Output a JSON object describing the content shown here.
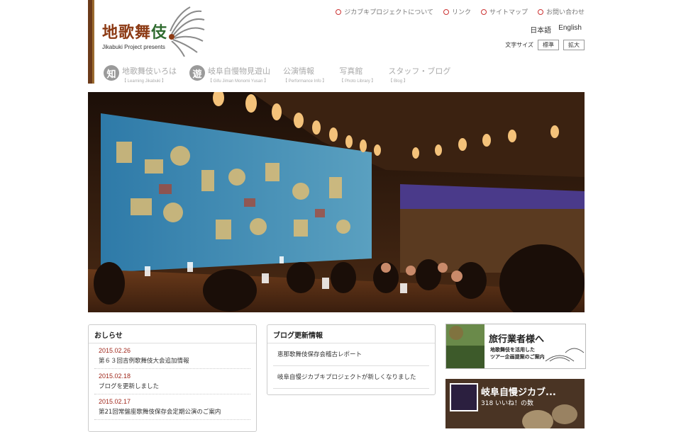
{
  "header": {
    "logo_title_a": "地歌舞",
    "logo_title_b": "伎",
    "logo_sub": "Jikabuki Project presents",
    "top_links": [
      {
        "label": "ジカブキプロジェクトについて"
      },
      {
        "label": "リンク"
      },
      {
        "label": "サイトマップ"
      },
      {
        "label": "お問い合わせ"
      }
    ],
    "lang": {
      "ja": "日本語",
      "en": "English"
    },
    "font_size": {
      "label": "文字サイズ",
      "normal": "標準",
      "large": "拡大"
    }
  },
  "gnav": [
    {
      "badge": "知",
      "jp": "地歌舞伎いろは",
      "en": "【 Learning Jikabuki 】"
    },
    {
      "badge": "遊",
      "jp": "岐阜自慢物見遊山",
      "en": "【 Gifu Jiman Monomi Yusan 】"
    },
    {
      "badge": "",
      "jp": "公演情報",
      "en": "【 Performance Info 】"
    },
    {
      "badge": "",
      "jp": "写真館",
      "en": "【 Photo Library 】"
    },
    {
      "badge": "",
      "jp": "スタッフ・ブログ",
      "en": "【 Blog 】"
    }
  ],
  "news": {
    "title": "おしらせ",
    "items": [
      {
        "date": "2015.02.26",
        "title": "第６３回吉例歌舞伎大会追加情報"
      },
      {
        "date": "2015.02.18",
        "title": "ブログを更新しました"
      },
      {
        "date": "2015.02.17",
        "title": "第21回常盤座歌舞伎保存会定期公演のご案内"
      }
    ]
  },
  "blog": {
    "title": "ブログ更新情報",
    "items": [
      {
        "title": "恵那歌舞伎保存会稽古レポート"
      },
      {
        "title": "岐阜自慢ジカブキプロジェクトが新しくなりました"
      }
    ]
  },
  "banner": {
    "title": "旅行業者様へ",
    "line1": "地歌舞伎を活用した",
    "line2": "ツアー企画提案のご案内"
  },
  "facebook": {
    "name": "岐阜自慢ジカブ...",
    "likes": "318 いいね！の数"
  },
  "colors": {
    "accent": "#a0281c",
    "brand_brown": "#6b3a1a",
    "brand_green": "#2f6b2f"
  }
}
